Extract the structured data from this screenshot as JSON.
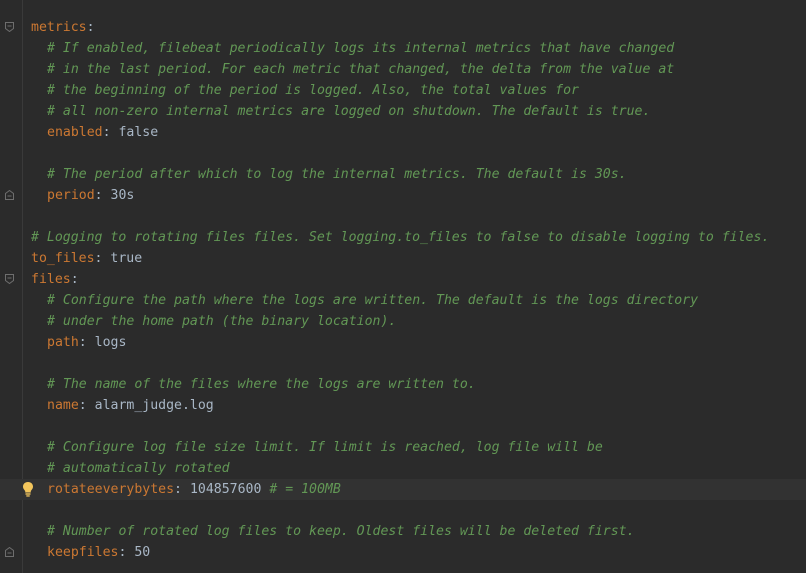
{
  "editor": {
    "lines": [
      {
        "indent": 0,
        "key": "metrics",
        "colon": ":",
        "value": "",
        "comment": "",
        "fold": "start"
      },
      {
        "indent": 1,
        "key": "",
        "colon": "",
        "value": "",
        "comment": "# If enabled, filebeat periodically logs its internal metrics that have changed",
        "fold": ""
      },
      {
        "indent": 1,
        "key": "",
        "colon": "",
        "value": "",
        "comment": "# in the last period. For each metric that changed, the delta from the value at",
        "fold": ""
      },
      {
        "indent": 1,
        "key": "",
        "colon": "",
        "value": "",
        "comment": "# the beginning of the period is logged. Also, the total values for",
        "fold": ""
      },
      {
        "indent": 1,
        "key": "",
        "colon": "",
        "value": "",
        "comment": "# all non-zero internal metrics are logged on shutdown. The default is true.",
        "fold": ""
      },
      {
        "indent": 1,
        "key": "enabled",
        "colon": ":",
        "value": " false",
        "comment": "",
        "fold": ""
      },
      {
        "indent": 0,
        "key": "",
        "colon": "",
        "value": "",
        "comment": "",
        "fold": ""
      },
      {
        "indent": 1,
        "key": "",
        "colon": "",
        "value": "",
        "comment": "# The period after which to log the internal metrics. The default is 30s.",
        "fold": ""
      },
      {
        "indent": 1,
        "key": "period",
        "colon": ":",
        "value": " 30s",
        "comment": "",
        "fold": "end"
      },
      {
        "indent": 0,
        "key": "",
        "colon": "",
        "value": "",
        "comment": "",
        "fold": ""
      },
      {
        "indent": 0,
        "key": "",
        "colon": "",
        "value": "",
        "comment": "# Logging to rotating files files. Set logging.to_files to false to disable logging to files.",
        "fold": ""
      },
      {
        "indent": 0,
        "key": "to_files",
        "colon": ":",
        "value": " true",
        "comment": "",
        "fold": ""
      },
      {
        "indent": 0,
        "key": "files",
        "colon": ":",
        "value": "",
        "comment": "",
        "fold": "start"
      },
      {
        "indent": 1,
        "key": "",
        "colon": "",
        "value": "",
        "comment": "# Configure the path where the logs are written. The default is the logs directory",
        "fold": ""
      },
      {
        "indent": 1,
        "key": "",
        "colon": "",
        "value": "",
        "comment": "# under the home path (the binary location).",
        "fold": ""
      },
      {
        "indent": 1,
        "key": "path",
        "colon": ":",
        "value": " logs",
        "comment": "",
        "fold": ""
      },
      {
        "indent": 0,
        "key": "",
        "colon": "",
        "value": "",
        "comment": "",
        "fold": ""
      },
      {
        "indent": 1,
        "key": "",
        "colon": "",
        "value": "",
        "comment": "# The name of the files where the logs are written to.",
        "fold": ""
      },
      {
        "indent": 1,
        "key": "name",
        "colon": ":",
        "value": " alarm_judge.log",
        "comment": "",
        "fold": ""
      },
      {
        "indent": 0,
        "key": "",
        "colon": "",
        "value": "",
        "comment": "",
        "fold": ""
      },
      {
        "indent": 1,
        "key": "",
        "colon": "",
        "value": "",
        "comment": "# Configure log file size limit. If limit is reached, log file will be",
        "fold": ""
      },
      {
        "indent": 1,
        "key": "",
        "colon": "",
        "value": "",
        "comment": "# automatically rotated",
        "fold": ""
      },
      {
        "indent": 1,
        "key": "rotateeverybytes",
        "colon": ":",
        "value": " 104857600 ",
        "comment": "# = 100MB",
        "fold": "",
        "current": true,
        "bulb": "lightbulb-icon"
      },
      {
        "indent": 0,
        "key": "",
        "colon": "",
        "value": "",
        "comment": "",
        "fold": ""
      },
      {
        "indent": 1,
        "key": "",
        "colon": "",
        "value": "",
        "comment": "# Number of rotated log files to keep. Oldest files will be deleted first.",
        "fold": ""
      },
      {
        "indent": 1,
        "key": "keepfiles",
        "colon": ":",
        "value": " 50",
        "comment": "",
        "fold": "end"
      }
    ]
  },
  "colors": {
    "background": "#2b2b2b",
    "key": "#cc7832",
    "value": "#a9b7c6",
    "comment": "#629755",
    "current_line": "#323232",
    "bulb": "#f2c55c"
  }
}
